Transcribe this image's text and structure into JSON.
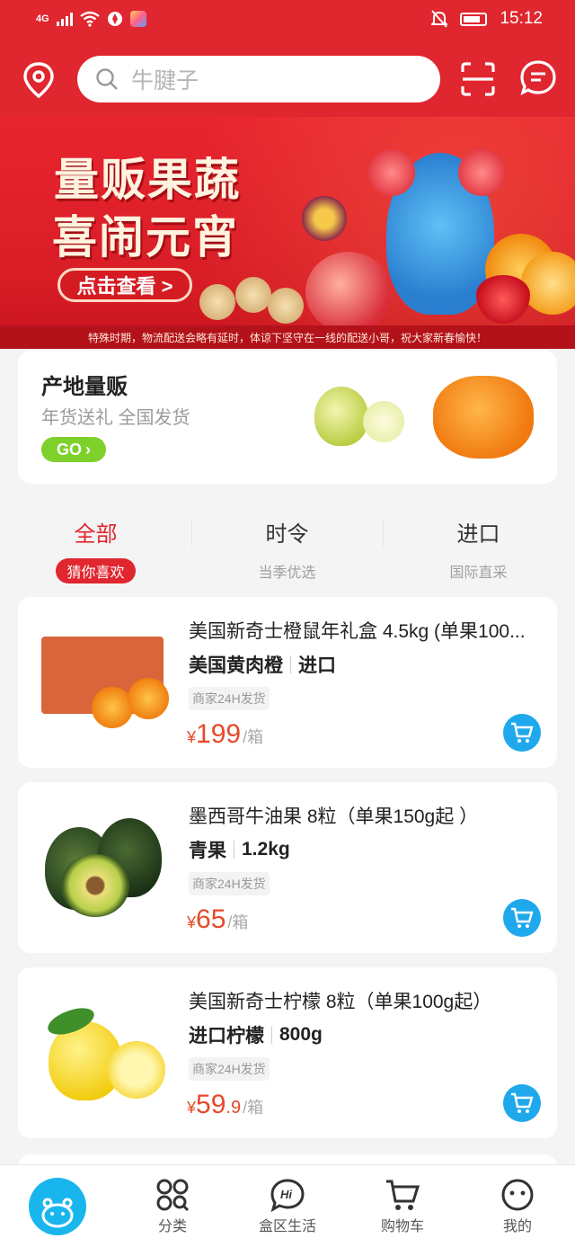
{
  "status_bar": {
    "network": "4G",
    "time": "15:12"
  },
  "header": {
    "search_placeholder": "牛腱子",
    "icons": [
      "location-icon",
      "search-icon",
      "scan-icon",
      "message-icon"
    ]
  },
  "banner": {
    "title_line1": "量贩果蔬",
    "title_line2": "喜闹元宵",
    "cta": "点击查看 >",
    "notice": "特殊时期，物流配送会略有延时，体谅下坚守在一线的配送小哥，祝大家新春愉快！"
  },
  "origin_card": {
    "title": "产地量贩",
    "subtitle": "年货送礼 全国发货",
    "go_label": "GO"
  },
  "tabs": [
    {
      "label": "全部",
      "sub": "猜你喜欢",
      "active": true
    },
    {
      "label": "时令",
      "sub": "当季优选",
      "active": false
    },
    {
      "label": "进口",
      "sub": "国际直采",
      "active": false
    }
  ],
  "products": [
    {
      "name": "美国新奇士橙鼠年礼盒 4.5kg (单果100...",
      "spec_a": "美国黄肉橙",
      "spec_b": "进口",
      "tag": "商家24H发货",
      "currency": "¥",
      "price_int": "199",
      "price_dec": "",
      "unit": "/箱"
    },
    {
      "name": "墨西哥牛油果 8粒（单果150g起 ）",
      "spec_a": "青果",
      "spec_b": "1.2kg",
      "tag": "商家24H发货",
      "currency": "¥",
      "price_int": "65",
      "price_dec": "",
      "unit": "/箱"
    },
    {
      "name": "美国新奇士柠檬 8粒（单果100g起）",
      "spec_a": "进口柠檬",
      "spec_b": "800g",
      "tag": "商家24H发货",
      "currency": "¥",
      "price_int": "59",
      "price_dec": ".9",
      "unit": "/箱"
    }
  ],
  "bottom_nav": [
    {
      "label": "",
      "icon": "home-hippo-icon"
    },
    {
      "label": "分类",
      "icon": "category-icon"
    },
    {
      "label": "盒区生活",
      "icon": "hi-chat-icon"
    },
    {
      "label": "购物车",
      "icon": "cart-icon"
    },
    {
      "label": "我的",
      "icon": "profile-icon"
    }
  ],
  "colors": {
    "brand_red": "#e0262f",
    "price_orange": "#e64a2a",
    "cart_blue": "#1fa9ec",
    "go_green": "#7dd12a"
  }
}
